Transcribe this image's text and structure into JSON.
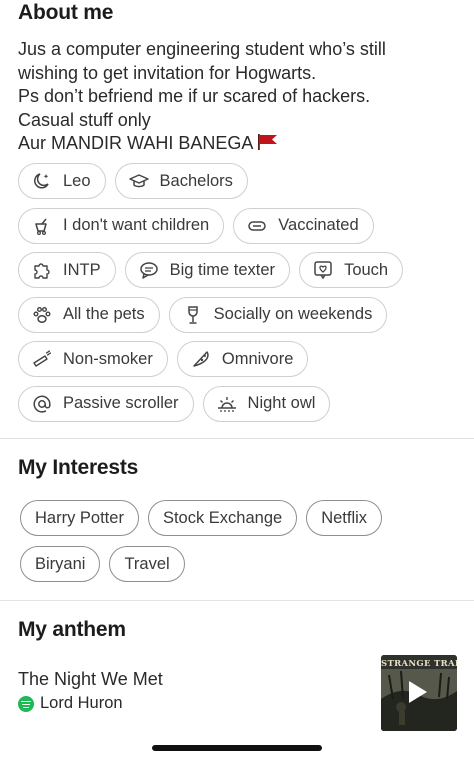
{
  "about": {
    "title": "About me",
    "bio": [
      "Jus a computer engineering student who’s still",
      "wishing to get invitation for Hogwarts.",
      "Ps don’t befriend me if ur scared of hackers.",
      "Casual stuff only",
      "Aur MANDIR WAHI BANEGA"
    ],
    "flag_icon": "red-flag-icon",
    "chips": [
      [
        {
          "label": "Leo",
          "icon": "moon-star-icon"
        },
        {
          "label": "Bachelors",
          "icon": "graduation-cap-icon"
        }
      ],
      [
        {
          "label": "I don't want children",
          "icon": "no-children-icon"
        },
        {
          "label": "Vaccinated",
          "icon": "vaccine-icon"
        }
      ],
      [
        {
          "label": "INTP",
          "icon": "puzzle-icon"
        },
        {
          "label": "Big time texter",
          "icon": "chat-bubble-icon"
        },
        {
          "label": "Touch",
          "icon": "heart-message-icon"
        }
      ],
      [
        {
          "label": "All the pets",
          "icon": "paw-icon"
        },
        {
          "label": "Socially on weekends",
          "icon": "glass-icon"
        }
      ],
      [
        {
          "label": "Non-smoker",
          "icon": "no-smoking-icon"
        },
        {
          "label": "Omnivore",
          "icon": "pizza-slice-icon"
        }
      ],
      [
        {
          "label": "Passive scroller",
          "icon": "at-sign-icon"
        },
        {
          "label": "Night owl",
          "icon": "sunset-icon"
        }
      ]
    ]
  },
  "interests": {
    "title": "My Interests",
    "items": [
      [
        "Harry Potter",
        "Stock Exchange",
        "Netflix"
      ],
      [
        "Biryani",
        "Travel"
      ]
    ]
  },
  "anthem": {
    "title": "My anthem",
    "song": "The Night We Met",
    "artist": "Lord Huron",
    "album_text": "STRANGE TRAILS",
    "service_icon": "spotify-icon",
    "colors": {
      "spotify": "#1db954"
    }
  },
  "colors": {
    "chip_border": "#cfcfcf",
    "pill_border": "#8f8f8f",
    "text": "#2a2a2a",
    "flag": "#c0141b"
  }
}
